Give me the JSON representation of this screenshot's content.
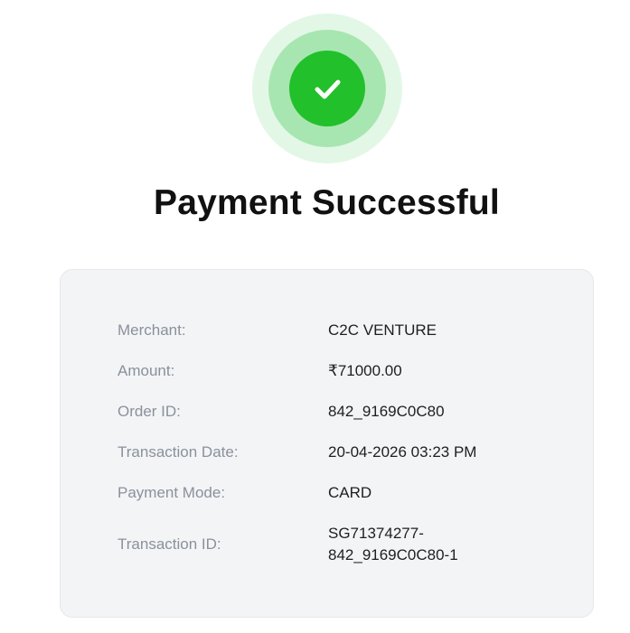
{
  "status": {
    "title": "Payment Successful",
    "icon": "checkmark-icon",
    "colors": {
      "outer_ring": "#e3f7e6",
      "middle_ring": "#a8e6b1",
      "inner_circle": "#22c02b",
      "check": "#ffffff"
    }
  },
  "details": [
    {
      "label": "Merchant:",
      "value": "C2C VENTURE"
    },
    {
      "label": "Amount:",
      "value": "₹71000.00"
    },
    {
      "label": "Order ID:",
      "value": "842_9169C0C80"
    },
    {
      "label": "Transaction Date:",
      "value": "20-04-2026 03:23 PM"
    },
    {
      "label": "Payment Mode:",
      "value": "CARD"
    },
    {
      "label": "Transaction ID:",
      "value_lines": [
        "SG71374277-",
        "842_9169C0C80-1"
      ]
    }
  ]
}
